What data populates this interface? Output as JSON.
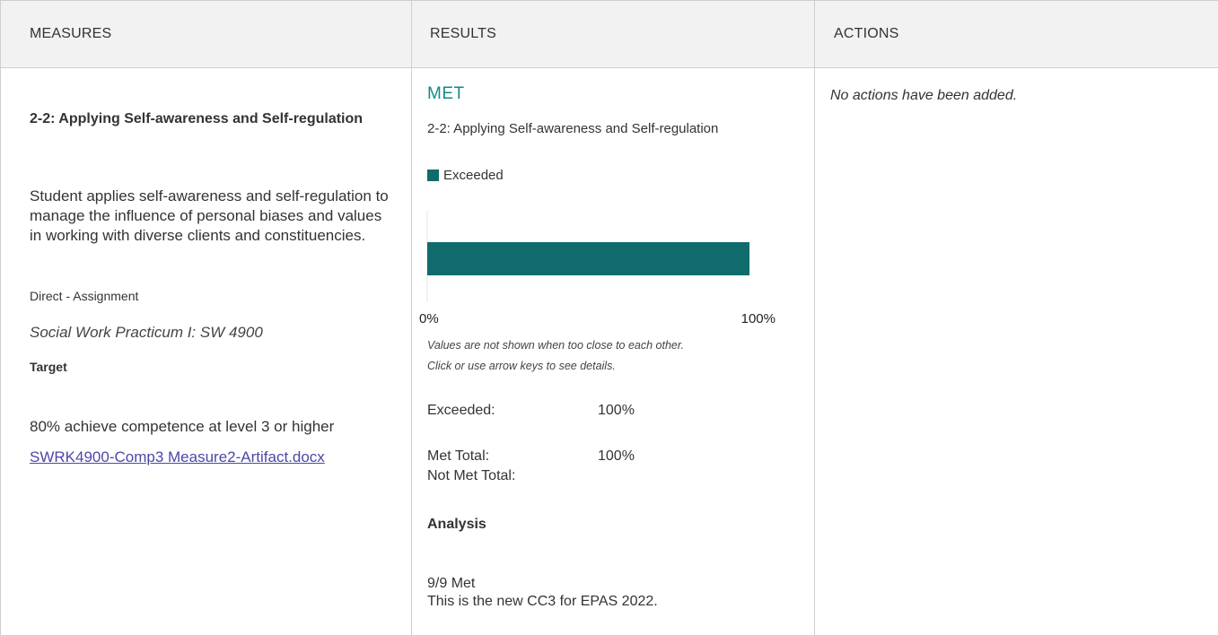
{
  "header": {
    "measures": "MEASURES",
    "results": "RESULTS",
    "actions": "ACTIONS"
  },
  "measure": {
    "title": "2-2: Applying Self-awareness and Self-regulation",
    "description": "Student applies self-awareness and self-regulation to manage the influence of personal biases and values in working with diverse clients and constituencies.",
    "type": "Direct - Assignment",
    "course": "Social Work Practicum I: SW 4900",
    "target_label": "Target",
    "target_text": "80% achieve competence at level 3 or higher",
    "artifact_link": "SWRK4900-Comp3 Measure2-Artifact.docx"
  },
  "result": {
    "status": "MET",
    "title": "2-2: Applying Self-awareness and Self-regulation",
    "legend_label": "Exceeded",
    "note_line1": "Values are not shown when too close to each other.",
    "note_line2": "Click or use arrow keys to see details.",
    "stats": {
      "exceeded_label": "Exceeded:",
      "exceeded_value": "100%",
      "met_total_label": "Met Total:",
      "met_total_value": "100%",
      "not_met_total_label": "Not Met Total:"
    },
    "analysis_label": "Analysis",
    "analysis_line1": "9/9 Met",
    "analysis_line2": "This is the new CC3 for EPAS 2022."
  },
  "chart_data": {
    "type": "bar",
    "orientation": "horizontal",
    "categories": [
      "2-2: Applying Self-awareness and Self-regulation"
    ],
    "series": [
      {
        "name": "Exceeded",
        "values": [
          100
        ],
        "color": "#0f6b6c"
      }
    ],
    "xlim": [
      0,
      100
    ],
    "tick_labels": [
      "0%",
      "100%"
    ]
  },
  "actions": {
    "empty_text": "No actions have been added."
  },
  "colors": {
    "accent": "#128a8a",
    "bar": "#0f6b6c",
    "link": "#4a48a8"
  }
}
